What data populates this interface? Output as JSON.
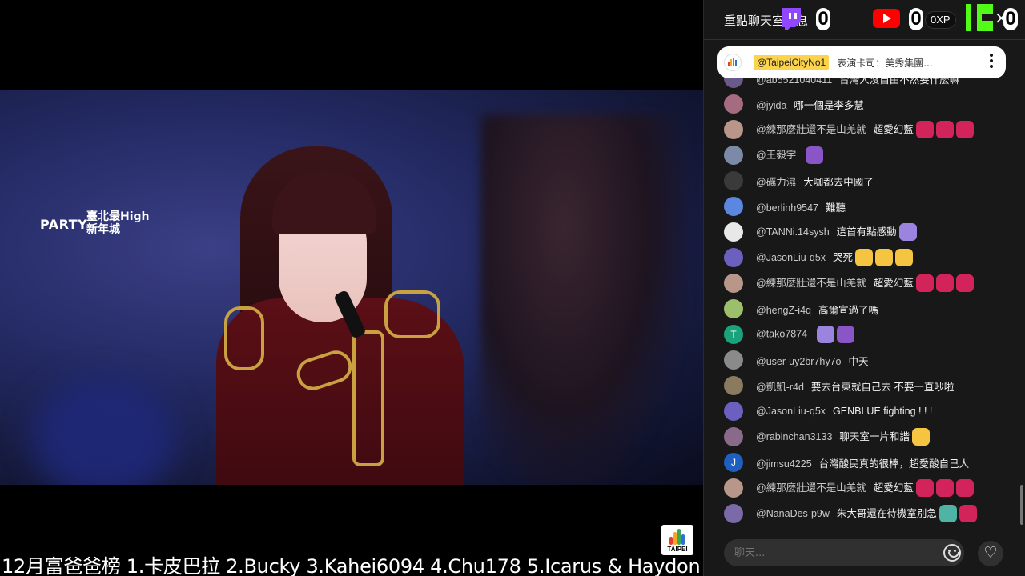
{
  "video": {
    "overlay_logo_left": "PARTY",
    "overlay_logo_right": "臺北最High 新年城",
    "badge_label": "TAIPEI"
  },
  "ticker": {
    "text": "12月富爸爸榜 1.卡皮巴拉 2.Bucky 3.Kahei6094 4.Chu178 5.Icarus & Haydon"
  },
  "chat": {
    "title": "重點聊天室訊息",
    "twitch_count": "0",
    "youtube_count": "0",
    "xp_label": "0XP",
    "kick_count": "0",
    "close_label": "×",
    "pinned": {
      "handle": "@TaipeiCityNo1",
      "message": "表演卡司：美秀集團..."
    },
    "messages": [
      {
        "name": "@ab5521040411",
        "text": "台灣人沒自由不然要什麼嘛",
        "avatar_color": "#6a5a8a",
        "avatar_letter": "",
        "emojis": []
      },
      {
        "name": "@jyida",
        "text": "哪一個是李多慧",
        "avatar_color": "#a56b80",
        "avatar_letter": "",
        "emojis": []
      },
      {
        "name": "@練那麼壯還不是山羌就",
        "text": "超愛幻藍",
        "avatar_color": "#b8968a",
        "avatar_letter": "",
        "emojis": [
          "#d2245a",
          "#d2245a",
          "#d2245a"
        ]
      },
      {
        "name": "@王毅宇",
        "text": "",
        "avatar_color": "#7c8aa8",
        "avatar_letter": "",
        "emojis": [
          "#8a56c7"
        ]
      },
      {
        "name": "@礪力濕",
        "text": "大咖都去中國了",
        "avatar_color": "#3a3a3a",
        "avatar_letter": "",
        "emojis": []
      },
      {
        "name": "@berlinh9547",
        "text": "難聽",
        "avatar_color": "#5b87e0",
        "avatar_letter": "",
        "emojis": []
      },
      {
        "name": "@TANNi.14sysh",
        "text": "這首有點感動",
        "avatar_color": "#e8e8e8",
        "avatar_letter": "",
        "emojis": [
          "#9b84e0"
        ]
      },
      {
        "name": "@JasonLiu-q5x",
        "text": "哭死",
        "avatar_color": "#6b5fbf",
        "avatar_letter": "",
        "emojis": [
          "#f5c542",
          "#f5c542",
          "#f5c542"
        ]
      },
      {
        "name": "@練那麼壯還不是山羌就",
        "text": "超愛幻藍",
        "avatar_color": "#b8968a",
        "avatar_letter": "",
        "emojis": [
          "#d2245a",
          "#d2245a",
          "#d2245a"
        ]
      },
      {
        "name": "@hengZ-i4q",
        "text": "高爾宣過了嗎",
        "avatar_color": "#9bbf6a",
        "avatar_letter": "",
        "emojis": []
      },
      {
        "name": "@tako7874",
        "text": "",
        "avatar_color": "#1aa37a",
        "avatar_letter": "T",
        "emojis": [
          "#9b84e0",
          "#8a56c7"
        ]
      },
      {
        "name": "@user-uy2br7hy7o",
        "text": "中天",
        "avatar_color": "#8a8a8a",
        "avatar_letter": "",
        "emojis": []
      },
      {
        "name": "@凱凱-r4d",
        "text": "要去台東就自己去 不要一直吵啦",
        "avatar_color": "#8a7a60",
        "avatar_letter": "",
        "emojis": []
      },
      {
        "name": "@JasonLiu-q5x",
        "text": "GENBLUE fighting ! ! !",
        "avatar_color": "#6b5fbf",
        "avatar_letter": "",
        "emojis": []
      },
      {
        "name": "@rabinchan3133",
        "text": "聊天室一片和諧",
        "avatar_color": "#8a6a8a",
        "avatar_letter": "",
        "emojis": [
          "#f5c542"
        ]
      },
      {
        "name": "@jimsu4225",
        "text": "台灣酸民真的很棒，超愛酸自己人",
        "avatar_color": "#1f5fbf",
        "avatar_letter": "J",
        "emojis": []
      },
      {
        "name": "@練那麼壯還不是山羌就",
        "text": "超愛幻藍",
        "avatar_color": "#b8968a",
        "avatar_letter": "",
        "emojis": [
          "#d2245a",
          "#d2245a",
          "#d2245a"
        ]
      },
      {
        "name": "@NanaDes-p9w",
        "text": "朱大哥還在待機室別急",
        "avatar_color": "#7a6aa8",
        "avatar_letter": "",
        "emojis": [
          "#4fb3a6",
          "#d2245a"
        ]
      }
    ],
    "input_placeholder": "聊天..."
  }
}
